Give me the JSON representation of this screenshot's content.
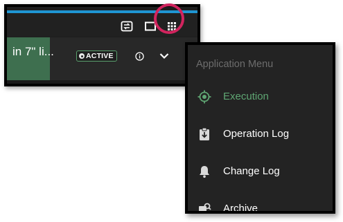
{
  "header": {
    "icons": [
      "swap-icon",
      "window-icon",
      "apps-grid-icon"
    ]
  },
  "row": {
    "title": "in 7\" li...",
    "status": "ACTIVE"
  },
  "menu": {
    "title": "Application Menu",
    "items": [
      {
        "label": "Execution",
        "icon": "target-icon",
        "active": true
      },
      {
        "label": "Operation Log",
        "icon": "clipboard-download-icon",
        "active": false
      },
      {
        "label": "Change Log",
        "icon": "bell-icon",
        "active": false
      },
      {
        "label": "Archive",
        "icon": "archive-search-icon",
        "active": false
      }
    ]
  },
  "colors": {
    "accent_blue": "#1f96d3",
    "active_green": "#5fa673",
    "highlight": "#d1245e"
  }
}
